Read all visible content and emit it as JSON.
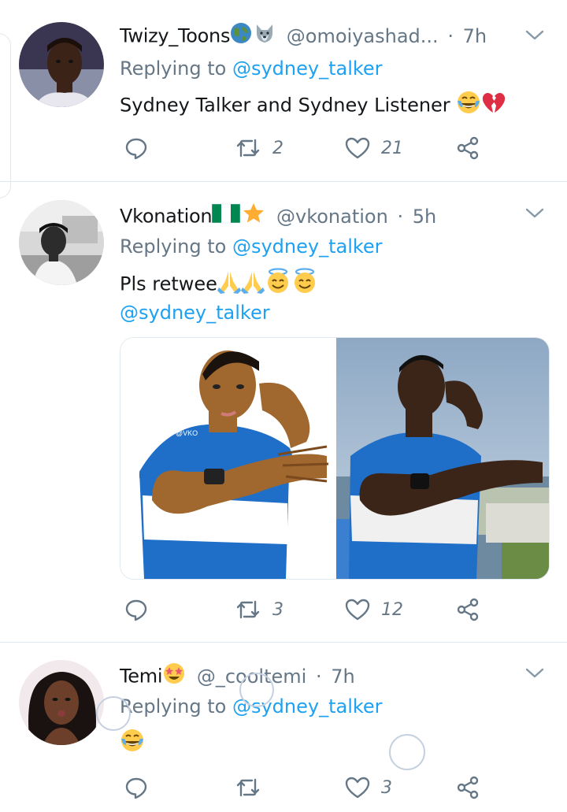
{
  "tweets": [
    {
      "name": "Twizy_Toons",
      "name_emojis": "globe, wolf",
      "handle": "@omoiyashad...",
      "dot": "·",
      "time": "7h",
      "replying_prefix": "Replying to",
      "replying_to": "@sydney_talker",
      "text": "Sydney Talker and Sydney Listener",
      "text_emojis": "tears-of-joy, broken-heart",
      "reply_count": "",
      "retweet_count": "2",
      "like_count": "21"
    },
    {
      "name": "Vkonation",
      "name_emojis": "nigeria-flag, star",
      "handle": "@vkonation",
      "dot": "·",
      "time": "5h",
      "replying_prefix": "Replying to",
      "replying_to": "@sydney_talker",
      "text": "Pls retwee",
      "text_emojis": "folded-hands, folded-hands, smiling-halo, smiling-halo",
      "mention_line": "@sydney_talker",
      "media": [
        "cartoon illustration of man in blue and white shirt",
        "photo of man in blue and white shirt on rooftop"
      ],
      "reply_count": "",
      "retweet_count": "3",
      "like_count": "12"
    },
    {
      "name": "Temi",
      "name_emojis": "star-struck",
      "handle": "@_cooltemi",
      "dot": "·",
      "time": "7h",
      "replying_prefix": "Replying to",
      "replying_to": "@sydney_talker",
      "text": "",
      "text_emojis": "tears-of-joy",
      "reply_count": "",
      "retweet_count": "",
      "like_count": "3"
    }
  ],
  "colors": {
    "accent": "#1da1f2",
    "secondary_text": "#657786",
    "divider": "#e1e8ed"
  }
}
